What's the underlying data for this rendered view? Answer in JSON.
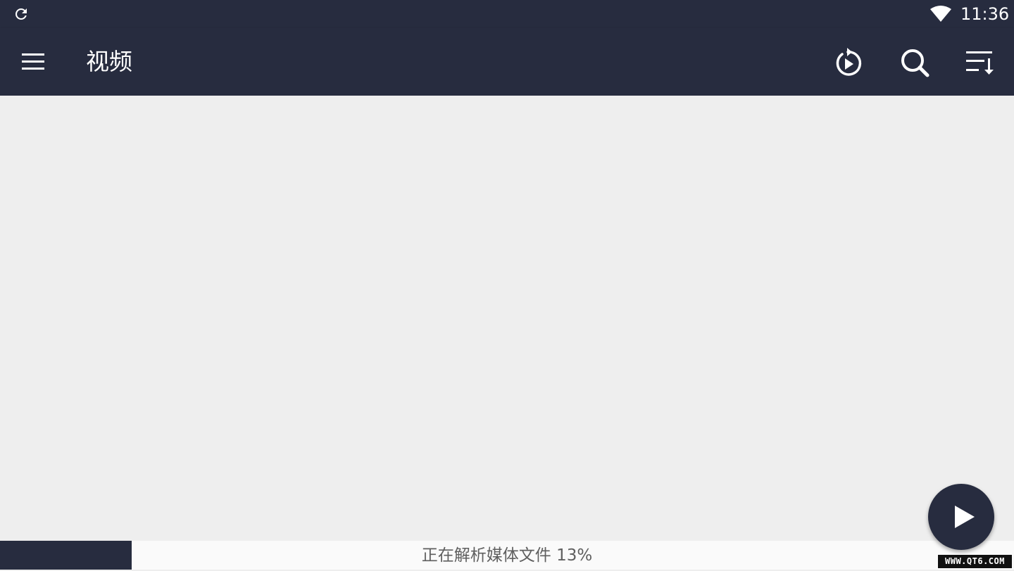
{
  "status_bar": {
    "time": "11:36",
    "icons": [
      "refresh-icon",
      "wifi-icon"
    ]
  },
  "app_bar": {
    "title": "视频",
    "menu_icon": "menu-icon",
    "actions": [
      {
        "name": "resume-playback",
        "icon": "replay-play-icon"
      },
      {
        "name": "search",
        "icon": "search-icon"
      },
      {
        "name": "sort",
        "icon": "sort-icon"
      }
    ]
  },
  "scan_progress": {
    "label": "正在解析媒体文件 13%",
    "percent": 13
  },
  "fab": {
    "icon": "play-icon"
  },
  "watermark": {
    "text": "WWW.QT6.COM"
  },
  "colors": {
    "bar": "#272c3f",
    "background": "#eeeeee",
    "progress_track": "#fafafa",
    "text_secondary": "#5f5f5f"
  }
}
